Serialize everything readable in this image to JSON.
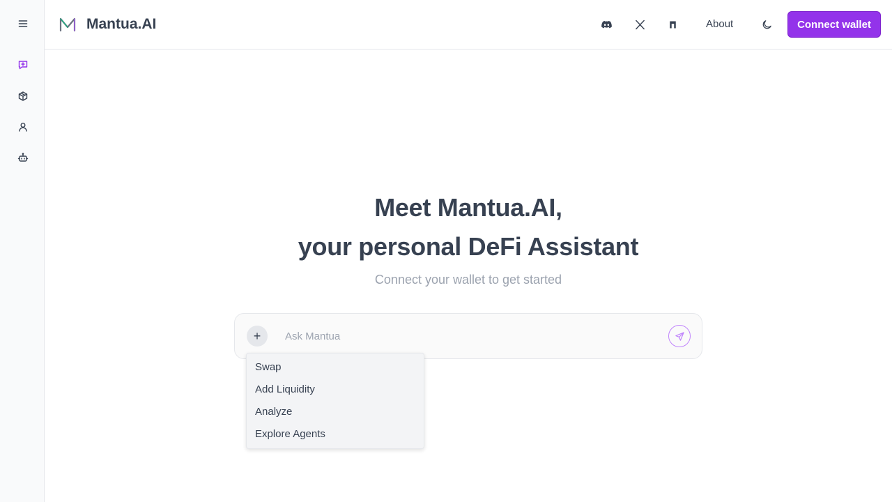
{
  "app": {
    "brand": "Mantua.AI",
    "accent_color": "#9333ea"
  },
  "sidebar": {
    "items": [
      {
        "icon": "menu-icon"
      },
      {
        "icon": "new-chat-icon",
        "active": true
      },
      {
        "icon": "cube-icon"
      },
      {
        "icon": "user-icon"
      },
      {
        "icon": "bot-icon"
      }
    ]
  },
  "header": {
    "icons": [
      "discord-icon",
      "x-twitter-icon",
      "docs-icon"
    ],
    "about_label": "About",
    "theme_icon": "moon-icon",
    "connect_label": "Connect wallet"
  },
  "hero": {
    "title_line1": "Meet Mantua.AI,",
    "title_line2": "your personal DeFi Assistant",
    "subtitle": "Connect your wallet to get started"
  },
  "chat": {
    "plus_label": "+",
    "placeholder": "Ask Mantua",
    "value": "",
    "send_icon": "send-icon"
  },
  "actions_menu": {
    "items": [
      "Swap",
      "Add Liquidity",
      "Analyze",
      "Explore Agents"
    ]
  }
}
